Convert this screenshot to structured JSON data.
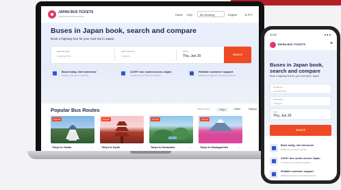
{
  "brand": {
    "name": "JAPAN BUS TICKETS",
    "tagline": "Japanese bus ticket booking"
  },
  "nav": {
    "links": [
      "Home",
      "FAQ"
    ],
    "my_booking": "My Booking",
    "language": "English",
    "currency": "$ JPY"
  },
  "hero": {
    "title": "Buses in Japan book, search and compare",
    "subtitle": "Book a highway bus for your next trip in Japan."
  },
  "search": {
    "departure_label": "DEPARTURE",
    "departure_placeholder": "Leaving from...",
    "destination_label": "DESTINATION",
    "destination_placeholder": "Going to...",
    "date_label": "DATE",
    "date_value": "Thu, Jun 20",
    "button": "Search"
  },
  "features": [
    {
      "title": "Book today, ride tomorrow",
      "sub": "Ready for tomorrow's journey."
    },
    {
      "title": "3,000+ bus routes across Japan",
      "sub": "Trusted by over 100 bus suppliers."
    },
    {
      "title": "Reliable customer support",
      "sub": "Multilingual support via email and phone."
    }
  ],
  "routes": {
    "title": "Popular Bus Routes",
    "depart_label": "Depart from",
    "filters": [
      "Tokyo",
      "Osaka",
      "Nagoya"
    ],
    "cards": [
      {
        "label": "Tokyo to Osaka",
        "badge": "Popular"
      },
      {
        "label": "Tokyo to Kyoto",
        "badge": "Popular"
      },
      {
        "label": "Tokyo to Kanazawa",
        "badge": "Popular"
      },
      {
        "label": "Tokyo to Kawaguchiko",
        "badge": "Popular"
      }
    ]
  },
  "phone": {
    "time": "10:02",
    "signal": "●●●",
    "heart_icon": "♡",
    "menu_icon": "≡",
    "swap_icon": "⇅",
    "title": "Buses in Japan book, search and compare",
    "subtitle": "Book a highway bus for your next trip in Japan.",
    "departure_label": "Departure",
    "departure_placeholder": "Leaving from...",
    "destination_label": "Destination",
    "destination_placeholder": "Going to...",
    "date_label": "Date",
    "date_value": "Thu, Jun 20",
    "button": "Search"
  },
  "colors": {
    "accent": "#ef4a23",
    "brand": "#e13b6a",
    "navy": "#1d2a4d",
    "banner": "#b31f26"
  }
}
